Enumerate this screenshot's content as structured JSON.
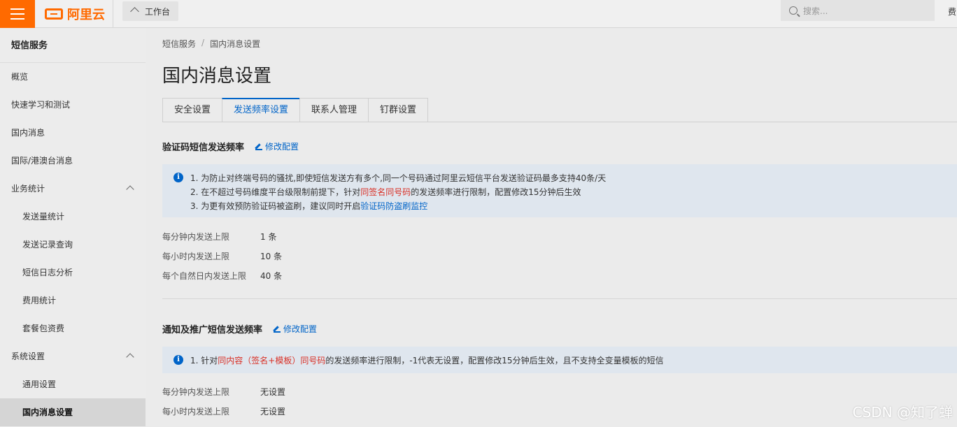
{
  "topbar": {
    "logo_text": "阿里云",
    "workbench_label": "工作台",
    "search_placeholder": "搜索...",
    "right_cut_text": "费"
  },
  "sidebar": {
    "title": "短信服务",
    "items": [
      {
        "label": "概览"
      },
      {
        "label": "快速学习和测试"
      },
      {
        "label": "国内消息"
      },
      {
        "label": "国际/港澳台消息"
      },
      {
        "label": "业务统计"
      },
      {
        "label": "发送量统计"
      },
      {
        "label": "发送记录查询"
      },
      {
        "label": "短信日志分析"
      },
      {
        "label": "费用统计"
      },
      {
        "label": "套餐包资费"
      },
      {
        "label": "系统设置"
      },
      {
        "label": "通用设置"
      },
      {
        "label": "国内消息设置"
      }
    ]
  },
  "main": {
    "breadcrumb": [
      "短信服务",
      "/",
      "国内消息设置"
    ],
    "page_title": "国内消息设置",
    "tabs": [
      {
        "label": "安全设置"
      },
      {
        "label": "发送频率设置"
      },
      {
        "label": "联系人管理"
      },
      {
        "label": "钉群设置"
      }
    ],
    "verify_section": {
      "title": "验证码短信发送频率",
      "edit_label": "修改配置",
      "notice": {
        "icon": "i",
        "line1": "1. 为防止对终端号码的骚扰,即使短信发送方有多个,同一个号码通过阿里云短信平台发送验证码最多支持40条/天",
        "line2_pre": "2. 在不超过号码维度平台级限制前提下，针对",
        "line2_red": "同签名同号码",
        "line2_post": "的发送频率进行限制，配置修改15分钟后生效",
        "line3_pre": "3. 为更有效预防验证码被盗刷，建议同时开启",
        "line3_link": "验证码防盗刷监控"
      },
      "rows": [
        {
          "key": "每分钟内发送上限",
          "value": "1 条"
        },
        {
          "key": "每小时内发送上限",
          "value": "10 条"
        },
        {
          "key": "每个自然日内发送上限",
          "value": "40 条"
        }
      ]
    },
    "notify_section": {
      "title": "通知及推广短信发送频率",
      "edit_label": "修改配置",
      "notice": {
        "icon": "i",
        "line1_pre": "1. 针对",
        "line1_red": "同内容（签名+模板）同号码",
        "line1_post": "的发送频率进行限制，-1代表无设置，配置修改15分钟后生效，且不支持全变量模板的短信"
      },
      "rows": [
        {
          "key": "每分钟内发送上限",
          "value": "无设置"
        },
        {
          "key": "每小时内发送上限",
          "value": "无设置"
        }
      ]
    }
  },
  "watermark": "CSDN @知了蝉"
}
